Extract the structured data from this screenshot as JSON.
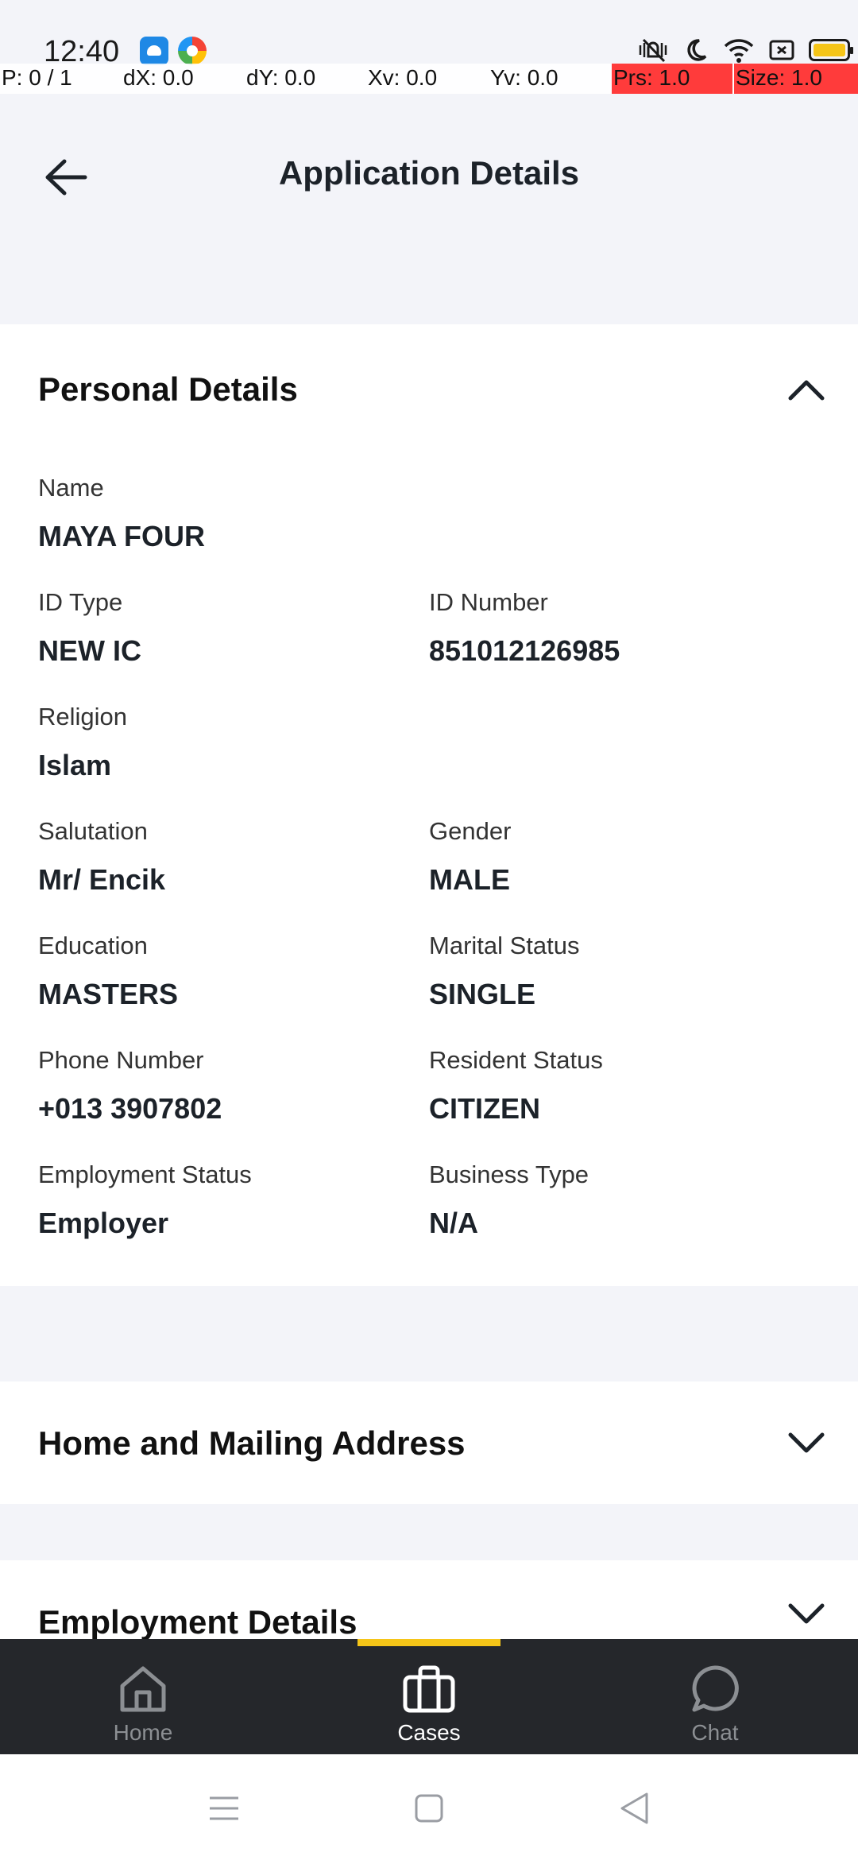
{
  "status_bar": {
    "time": "12:40",
    "app_icons": [
      "android-app-icon",
      "browser-app-icon"
    ],
    "system_icons": [
      "silent-vibrate-icon",
      "do-not-disturb-moon-icon",
      "wifi-icon",
      "sim-icon",
      "battery-icon"
    ],
    "battery_color": "#f5c518"
  },
  "pointer_overlay": {
    "p": "P: 0 / 1",
    "dx": "dX: 0.0",
    "dy": "dY: 0.0",
    "xv": "Xv: 0.0",
    "yv": "Yv: 0.0",
    "prs": "Prs: 1.0",
    "size": "Size: 1.0",
    "highlight_color": "#ff3b3b"
  },
  "header": {
    "title": "Application Details",
    "back_icon": "arrow-left-icon"
  },
  "personal_details": {
    "title": "Personal Details",
    "expanded": true,
    "fields": {
      "name": {
        "label": "Name",
        "value": "MAYA FOUR"
      },
      "id_type": {
        "label": "ID Type",
        "value": "NEW IC"
      },
      "id_number": {
        "label": "ID Number",
        "value": "851012126985"
      },
      "religion": {
        "label": "Religion",
        "value": "Islam"
      },
      "salutation": {
        "label": "Salutation",
        "value": "Mr/ Encik"
      },
      "gender": {
        "label": "Gender",
        "value": "MALE"
      },
      "education": {
        "label": "Education",
        "value": "MASTERS"
      },
      "marital_status": {
        "label": "Marital Status",
        "value": "SINGLE"
      },
      "phone_number": {
        "label": "Phone Number",
        "value": "+013 3907802"
      },
      "resident_status": {
        "label": "Resident Status",
        "value": "CITIZEN"
      },
      "employment_status": {
        "label": "Employment Status",
        "value": "Employer"
      },
      "business_type": {
        "label": "Business Type",
        "value": "N/A"
      }
    }
  },
  "address_section": {
    "title": "Home and Mailing Address",
    "expanded": false
  },
  "employment_section": {
    "title": "Employment Details",
    "expanded": false
  },
  "bottom_nav": {
    "active": "cases",
    "accent_color": "#f5c518",
    "items": [
      {
        "key": "home",
        "label": "Home",
        "icon": "home-icon"
      },
      {
        "key": "cases",
        "label": "Cases",
        "icon": "briefcase-icon"
      },
      {
        "key": "chat",
        "label": "Chat",
        "icon": "chat-bubble-icon"
      }
    ]
  },
  "system_nav": {
    "buttons": [
      "menu-icon",
      "home-square-icon",
      "back-triangle-icon"
    ]
  }
}
